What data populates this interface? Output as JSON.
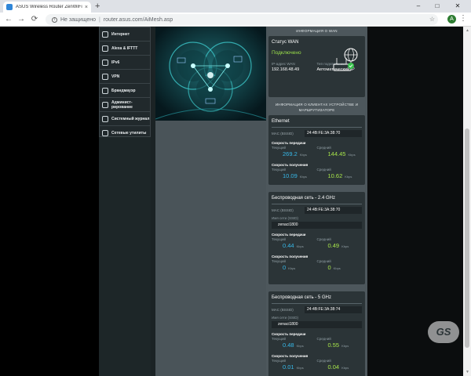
{
  "browser": {
    "tab_title": "ASUS Wireless Router ZenWiFi",
    "tab_close": "×",
    "new_tab": "+",
    "win_min": "–",
    "win_max": "□",
    "win_close": "✕",
    "back": "←",
    "forward": "→",
    "reload": "⟳",
    "insecure_label": "Не защищено",
    "separator": "|",
    "url": "router.asus.com/AiMesh.asp",
    "profile_initial": "A",
    "menu": "⋮",
    "star": "☆"
  },
  "sidebar": {
    "items": [
      {
        "label": "Интернет",
        "icon": "globe-icon"
      },
      {
        "label": "Alexa & IFTTT",
        "icon": "alexa-icon"
      },
      {
        "label": "IPv6",
        "icon": "ipv6-icon"
      },
      {
        "label": "VPN",
        "icon": "vpn-icon"
      },
      {
        "label": "Брандмауэр",
        "icon": "firewall-icon"
      },
      {
        "label": "Админист-рирование",
        "icon": "admin-icon"
      },
      {
        "label": "Системный журнал",
        "icon": "log-icon"
      },
      {
        "label": "Сетевые утилиты",
        "icon": "tools-icon"
      }
    ]
  },
  "wan": {
    "section_title": "ИНФОРМАЦИЯ О WAN",
    "card_title": "Статус WAN",
    "status": "Подключено",
    "ip_label": "IP-адрес WAN",
    "ip_value": "192.168.48.49",
    "conn_type_label": "Тип подключения",
    "conn_type_value": "Автоматический IP"
  },
  "devices_section": {
    "title_line1": "ИНФОРМАЦИЯ О КЛИЕНТАХ УСТРОЙСТВЕ И",
    "title_line2": "МАРШРУТИЗАТОРЕ"
  },
  "ethernet": {
    "title": "Ethernet",
    "mac_label": "MAC (BSSID)",
    "mac_value": "24:4B:FE:3A:38:70",
    "tx_title": "Скорость передачи",
    "rx_title": "Скорость получения",
    "current_label": "Текущий",
    "average_label": "Средний",
    "unit": "Kbps",
    "tx_current": "269.2",
    "tx_average": "144.45",
    "rx_current": "10.09",
    "rx_average": "10.62"
  },
  "wifi24": {
    "title": "Беспроводная сеть - 2.4 GHz",
    "mac_label": "MAC (BSSID)",
    "mac_value": "24:4B:FE:3A:38:70",
    "ssid_label": "Имя сети (SSID)",
    "ssid_value": "zenaci1800",
    "tx_title": "Скорость передачи",
    "rx_title": "Скорость получения",
    "current_label": "Текущий",
    "average_label": "Средний",
    "unit": "Kbps",
    "tx_current": "0.44",
    "tx_average": "0.49",
    "rx_current": "0",
    "rx_average": "0"
  },
  "wifi5": {
    "title": "Беспроводная сеть - 5 GHz",
    "mac_label": "MAC (BSSID)",
    "mac_value": "24:4B:FE:3A:38:74",
    "ssid_label": "Имя сети (SSID)",
    "ssid_value": "zenaci1800",
    "tx_title": "Скорость передачи",
    "rx_title": "Скорость получения",
    "current_label": "Текущий",
    "average_label": "Средний",
    "unit": "Kbps",
    "tx_current": "0.48",
    "tx_average": "0.55",
    "rx_current": "0.01",
    "rx_average": "0.04"
  },
  "watermark": "GS",
  "colors": {
    "current_speed": "#37b8e8",
    "average_speed": "#a6e34a",
    "connected": "#9be04a"
  }
}
